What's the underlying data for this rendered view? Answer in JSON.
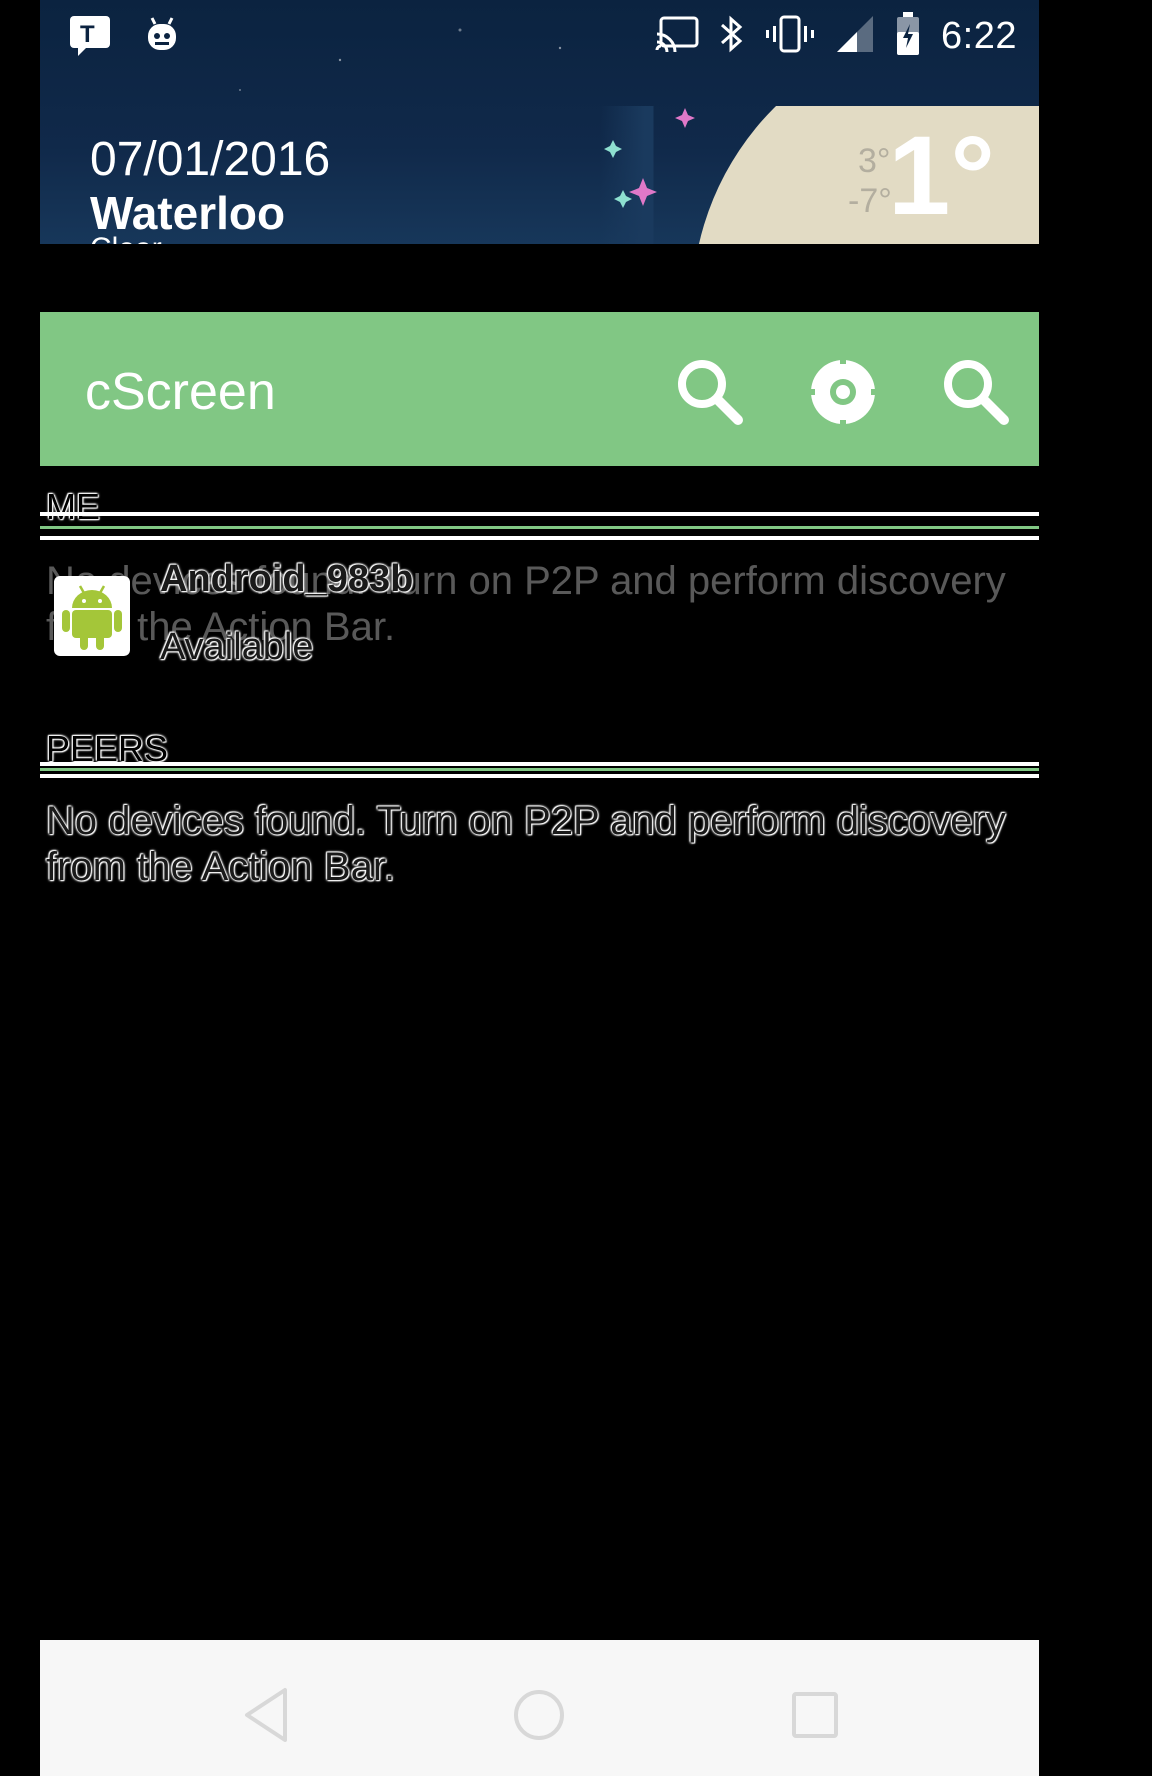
{
  "status_bar": {
    "time": "6:22",
    "left_icons": [
      "transit-notification-icon",
      "android-robot-notification-icon"
    ],
    "right_icons": [
      "cast-icon",
      "bluetooth-icon",
      "vibrate-icon",
      "signal-icon",
      "battery-icon"
    ]
  },
  "weather_widget": {
    "date": "07/01/2016",
    "city": "Waterloo",
    "condition": "Clear",
    "temp_high": "3°",
    "temp_low": "-7°",
    "temp_now": "1°"
  },
  "action_bar": {
    "title": "cScreen",
    "background": "#81c784",
    "buttons": [
      "search-icon",
      "settings-icon",
      "discover-icon"
    ]
  },
  "me_section": {
    "header": "ME",
    "device_name": "Android_983b",
    "device_status": "Available",
    "icon": "android-icon"
  },
  "peers_section": {
    "header": "PEERS",
    "empty_message": "No devices found. Turn on P2P and perform discovery from the Action Bar."
  },
  "nav_bar": {
    "buttons": [
      "back-icon",
      "home-icon",
      "recents-icon"
    ]
  }
}
